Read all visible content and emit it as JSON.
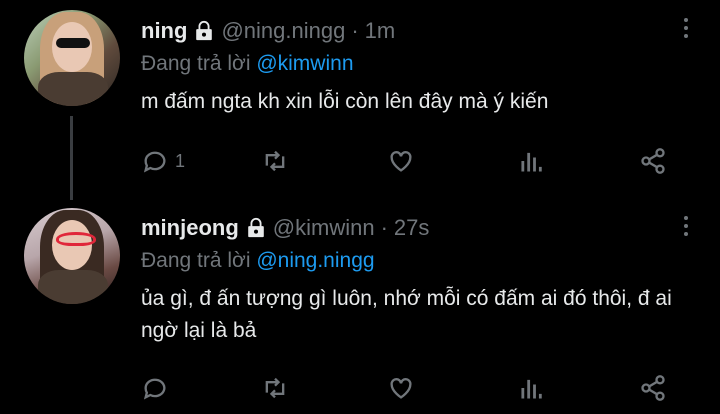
{
  "tweets": [
    {
      "name": "ning",
      "handle": "@ning.ningg",
      "dot": "·",
      "time": "1m",
      "reply_prefix": "Đang trả lời ",
      "reply_to": "@kimwinn",
      "text": "m đấm ngta kh xin lỗi còn lên đây mà ý kiến",
      "reply_count": "1",
      "icons": {
        "lock": "lock-icon",
        "more": "more-vertical-icon",
        "reply": "reply-icon",
        "retweet": "retweet-icon",
        "like": "heart-icon",
        "views": "analytics-icon",
        "share": "share-icon"
      }
    },
    {
      "name": "minjeong",
      "handle": "@kimwinn",
      "dot": "·",
      "time": "27s",
      "reply_prefix": "Đang trả lời ",
      "reply_to": "@ning.ningg",
      "text": "ủa gì, đ ấn tượng gì luôn, nhớ mỗi có đấm ai đó thôi, đ ai ngờ lại là bả",
      "reply_count": "",
      "icons": {
        "lock": "lock-icon",
        "more": "more-vertical-icon",
        "reply": "reply-icon",
        "retweet": "retweet-icon",
        "like": "heart-icon",
        "views": "analytics-icon",
        "share": "share-icon"
      }
    }
  ],
  "colors": {
    "background": "#000000",
    "text": "#e7e9ea",
    "muted": "#71767b",
    "mention": "#1d9bf0",
    "thread_line": "#3a3d41"
  }
}
